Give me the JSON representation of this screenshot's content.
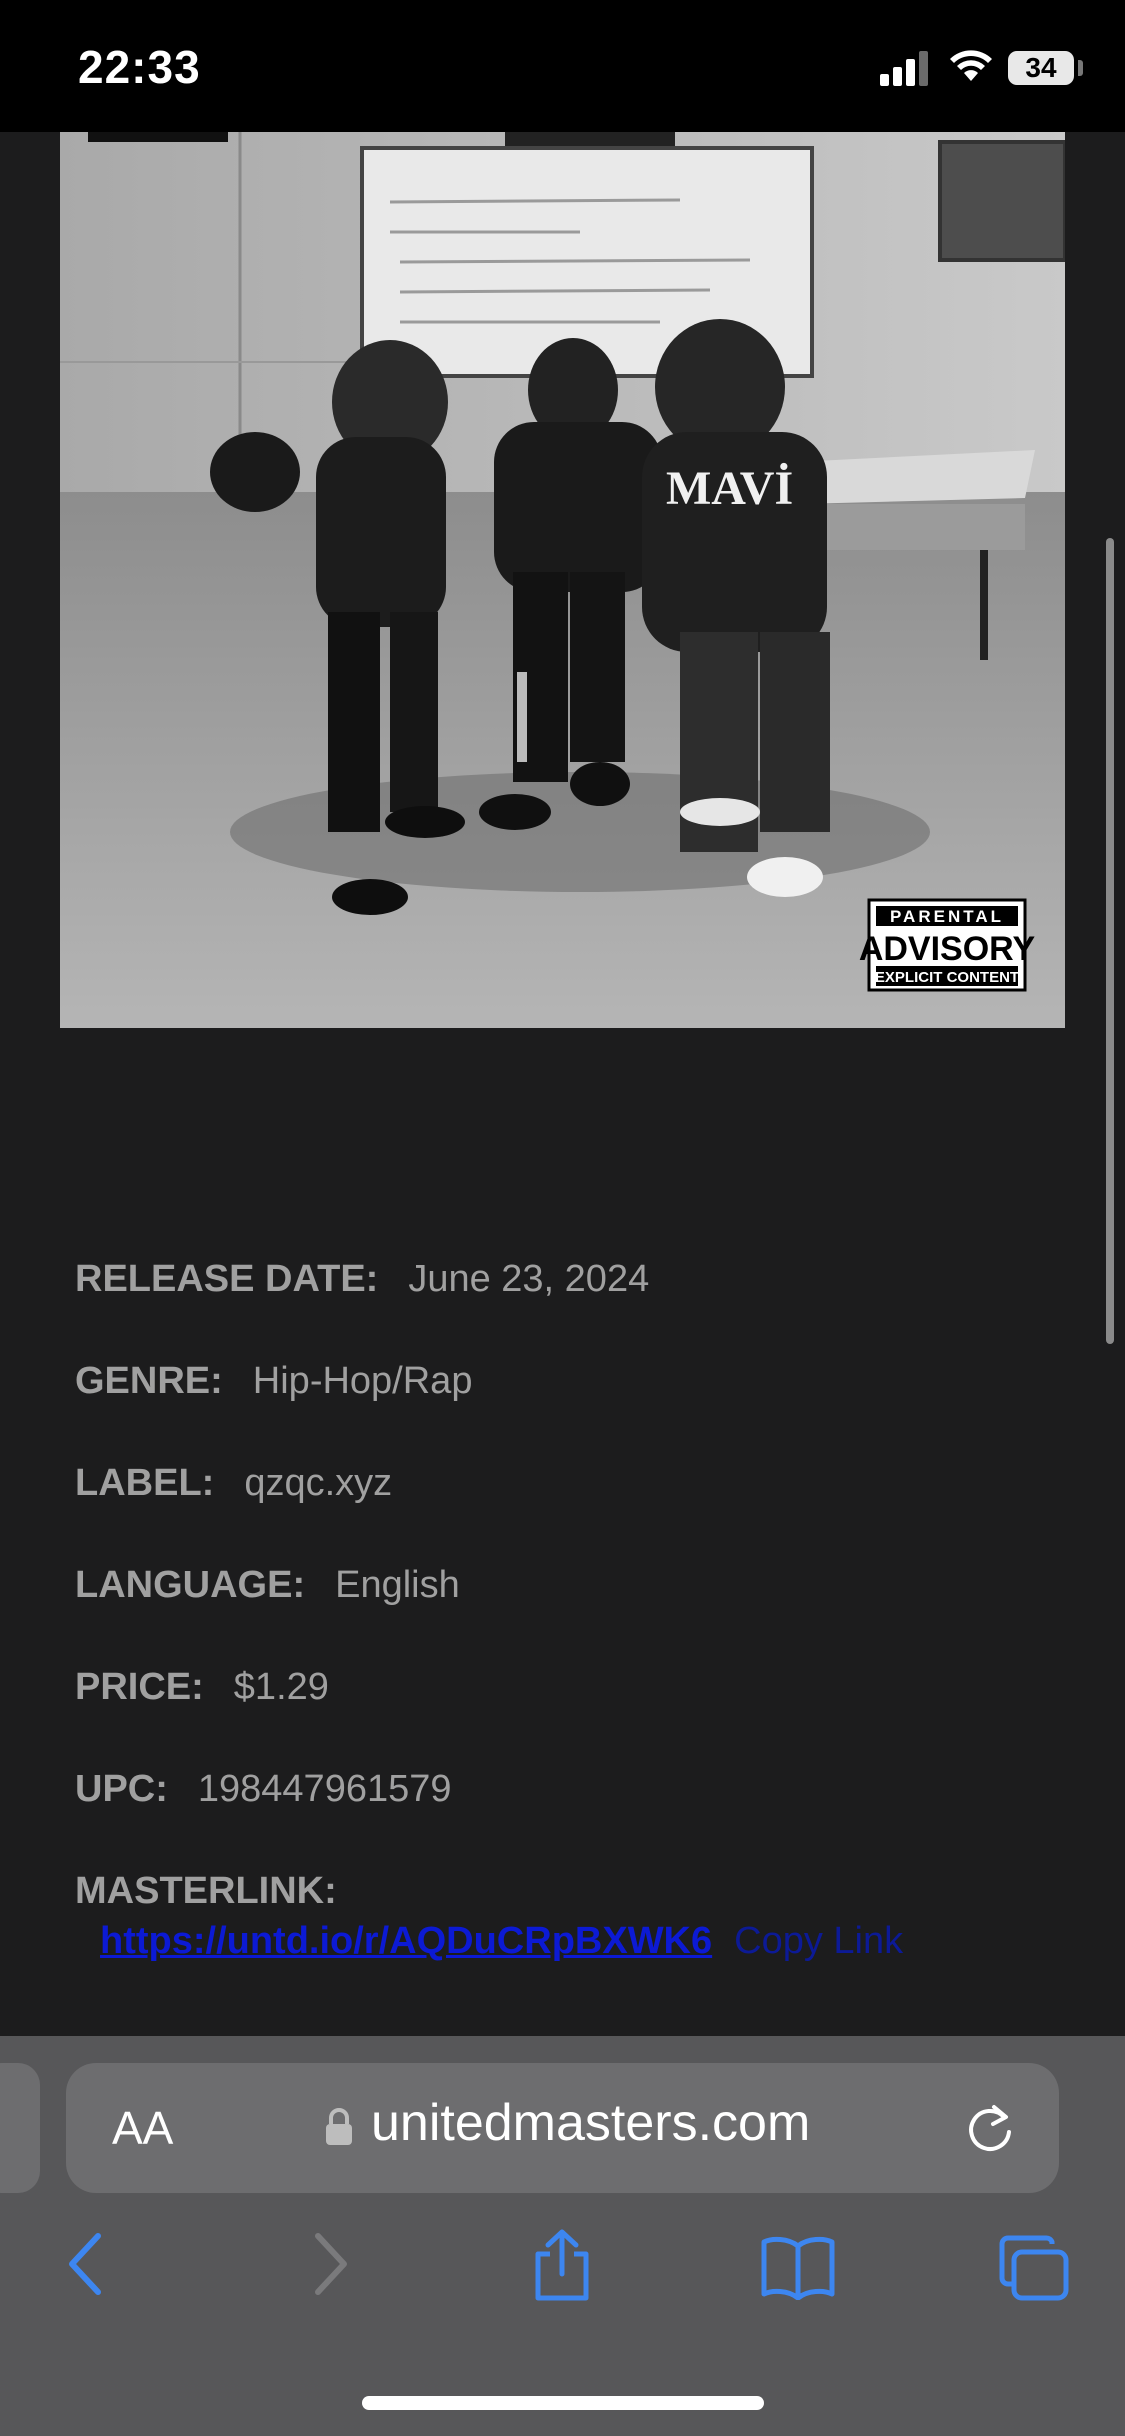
{
  "status_bar": {
    "time": "22:33",
    "battery": "34"
  },
  "cover": {
    "advisory_top": "PARENTAL",
    "advisory_mid": "ADVISORY",
    "advisory_bottom": "EXPLICIT CONTENT",
    "hoodie_text": "MAVİ"
  },
  "details": [
    {
      "label": "RELEASE DATE:",
      "value": "June 23, 2024"
    },
    {
      "label": "GENRE:",
      "value": "Hip-Hop/Rap"
    },
    {
      "label": "LABEL:",
      "value": "qzqc.xyz"
    },
    {
      "label": "LANGUAGE:",
      "value": "English"
    },
    {
      "label": "PRICE:",
      "value": "$1.29"
    },
    {
      "label": "UPC:",
      "value": "198447961579"
    }
  ],
  "masterlink": {
    "label": "MASTERLINK:",
    "url": "https://untd.io/r/AQDuCRpBXWK6",
    "copy_label": "Copy Link"
  },
  "browser": {
    "text_size_label": "AA",
    "host": "unitedmasters.com"
  },
  "colors": {
    "background": "#1c1c1d",
    "link": "#0c1ad4",
    "toolbar_icon": "#3d86f0"
  }
}
